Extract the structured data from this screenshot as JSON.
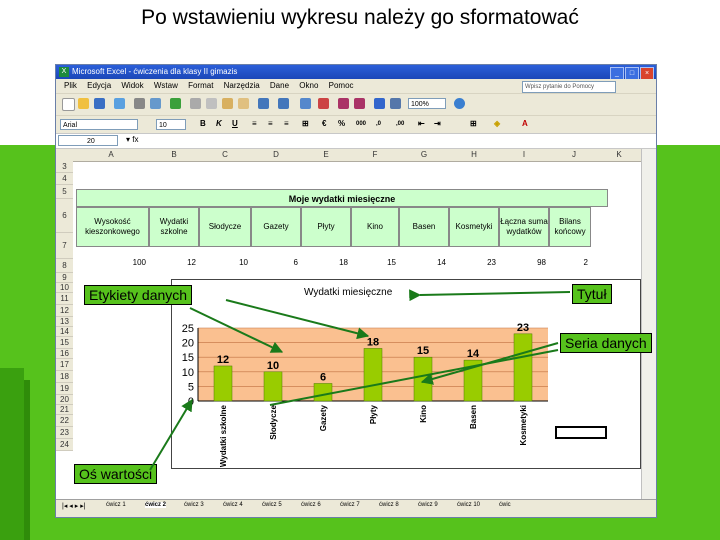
{
  "slide": {
    "title": "Po wstawieniu wykresu należy go sformatować"
  },
  "excel": {
    "window_title": "Microsoft Excel - ćwiczenia dla klasy II gimazis",
    "menu": [
      "Plik",
      "Edycja",
      "Widok",
      "Wstaw",
      "Format",
      "Narzędzia",
      "Dane",
      "Okno",
      "Pomoc"
    ],
    "ask_placeholder": "Wpisz pytanie do Pomocy",
    "font_name": "Arial",
    "font_size": "10",
    "zoom": "100%",
    "name_box": "20",
    "columns": [
      "A",
      "B",
      "C",
      "D",
      "E",
      "F",
      "G",
      "H",
      "I",
      "J",
      "K"
    ],
    "rows": [
      "3",
      "4",
      "5",
      "6",
      "7",
      "8",
      "9",
      "10",
      "11",
      "12",
      "13",
      "14",
      "15",
      "16",
      "17",
      "18",
      "19",
      "20",
      "21",
      "22",
      "23",
      "24"
    ],
    "sheet_tabs": [
      "ćwicz 1",
      "ćwicz 2",
      "ćwicz 3",
      "ćwicz 4",
      "ćwicz 5",
      "ćwicz 6",
      "ćwicz 7",
      "ćwicz 8",
      "ćwicz 9",
      "ćwicz 10",
      "ćwic"
    ],
    "active_sheet_tab": "ćwicz 2"
  },
  "table": {
    "title": "Moje wydatki miesięczne",
    "headers": [
      "Wysokość kieszonkowego",
      "Wydatki szkolne",
      "Słodycze",
      "Gazety",
      "Płyty",
      "Kino",
      "Basen",
      "Kosmetyki",
      "Łączna suma wydatków",
      "Bilans końcowy"
    ],
    "values": [
      "100",
      "12",
      "10",
      "6",
      "18",
      "15",
      "14",
      "23",
      "98",
      "2"
    ]
  },
  "chart_data": {
    "type": "bar",
    "title": "Wydatki miesięczne",
    "categories": [
      "Wydatki szkolne",
      "Słodycze",
      "Gazety",
      "Płyty",
      "Kino",
      "Basen",
      "Kosmetyki"
    ],
    "values": [
      12,
      10,
      6,
      18,
      15,
      14,
      23
    ],
    "ylim": [
      0,
      25
    ],
    "yticks": [
      "0",
      "5",
      "10",
      "15",
      "20",
      "25"
    ],
    "bar_color": "#99cc00",
    "plot_bg": "#fac090",
    "xlabel": "",
    "ylabel": ""
  },
  "callouts": {
    "data_labels": "Etykiety danych",
    "title": "Tytuł",
    "series": "Seria danych",
    "value_axis": "Oś wartości"
  },
  "colors": {
    "slide_green": "#56c21c",
    "table_header": "#ccffcc"
  }
}
